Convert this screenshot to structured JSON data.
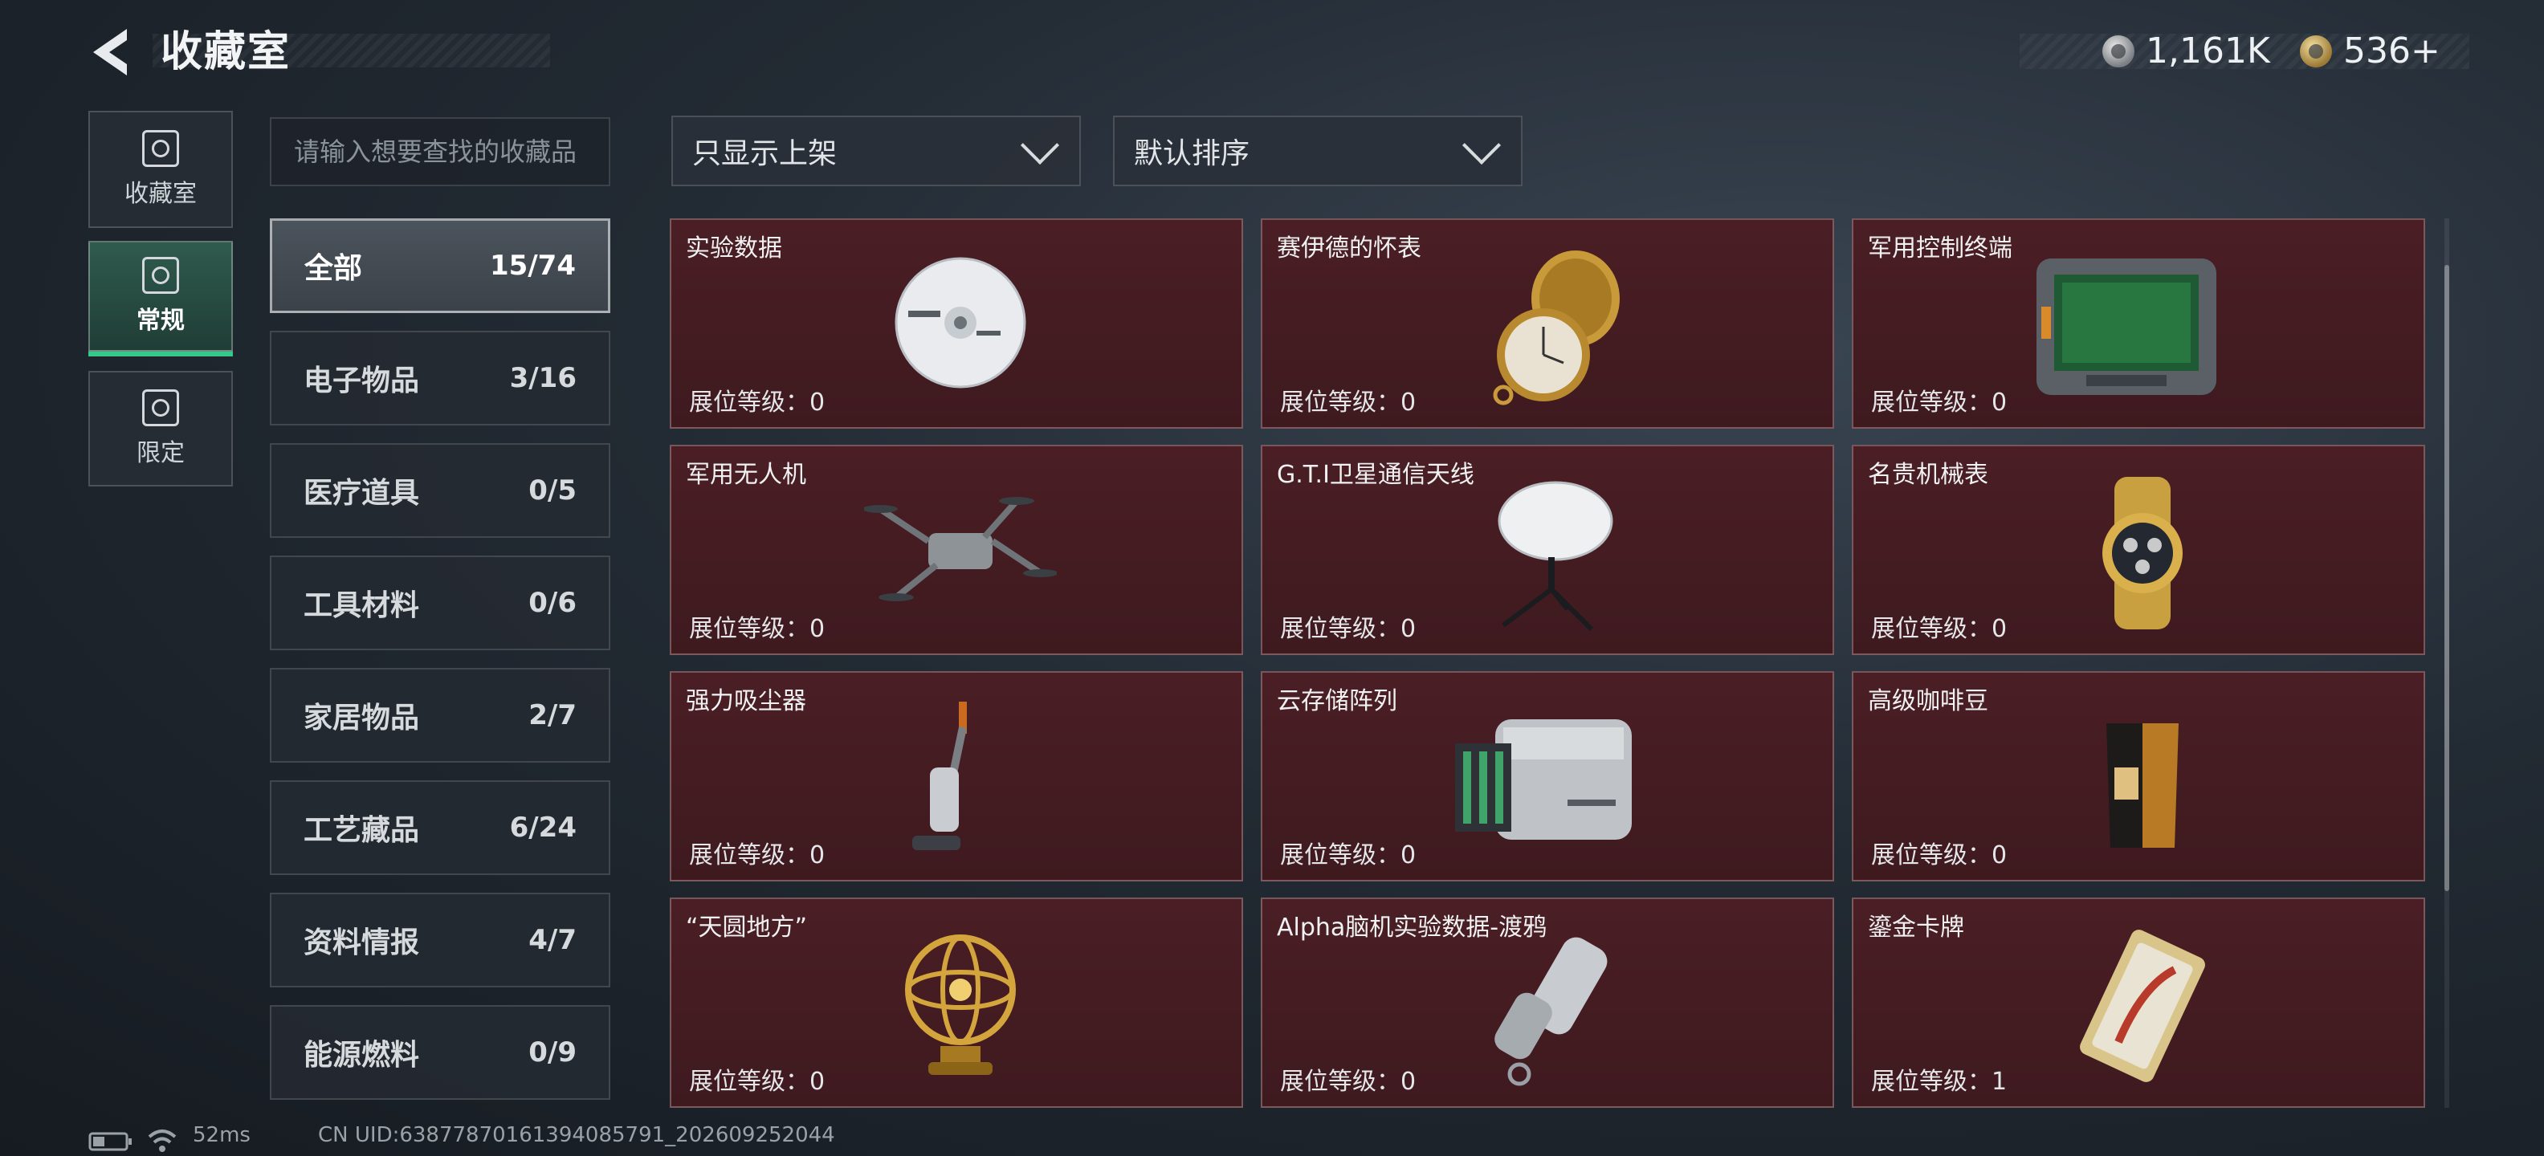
{
  "header": {
    "title": "收藏室",
    "currencies": [
      {
        "icon": "silver-coin-icon",
        "value": "1,161K"
      },
      {
        "icon": "gold-coin-icon",
        "value": "536+"
      }
    ]
  },
  "side_tabs": [
    {
      "label": "收藏室",
      "icon": "collection-room-icon",
      "active": false
    },
    {
      "label": "常规",
      "icon": "regular-icon",
      "active": true
    },
    {
      "label": "限定",
      "icon": "limited-icon",
      "active": false
    }
  ],
  "search": {
    "placeholder": "请输入想要查找的收藏品"
  },
  "filters": {
    "shelf": "只显示上架",
    "sort": "默认排序"
  },
  "categories": [
    {
      "name": "全部",
      "count": "15/74",
      "active": true
    },
    {
      "name": "电子物品",
      "count": "3/16"
    },
    {
      "name": "医疗道具",
      "count": "0/5"
    },
    {
      "name": "工具材料",
      "count": "0/6"
    },
    {
      "name": "家居物品",
      "count": "2/7"
    },
    {
      "name": "工艺藏品",
      "count": "6/24"
    },
    {
      "name": "资料情报",
      "count": "4/7"
    },
    {
      "name": "能源燃料",
      "count": "0/9"
    }
  ],
  "items": [
    {
      "name": "实验数据",
      "level": "展位等级：0",
      "icon": "disc-icon"
    },
    {
      "name": "赛伊德的怀表",
      "level": "展位等级：0",
      "icon": "pocket-watch-icon"
    },
    {
      "name": "军用控制终端",
      "level": "展位等级：0",
      "icon": "control-terminal-icon"
    },
    {
      "name": "军用无人机",
      "level": "展位等级：0",
      "icon": "drone-icon"
    },
    {
      "name": "G.T.I卫星通信天线",
      "level": "展位等级：0",
      "icon": "satellite-antenna-icon"
    },
    {
      "name": "名贵机械表",
      "level": "展位等级：0",
      "icon": "wristwatch-icon"
    },
    {
      "name": "强力吸尘器",
      "level": "展位等级：0",
      "icon": "vacuum-cleaner-icon"
    },
    {
      "name": "云存储阵列",
      "level": "展位等级：0",
      "icon": "storage-array-icon"
    },
    {
      "name": "高级咖啡豆",
      "level": "展位等级：0",
      "icon": "coffee-bag-icon"
    },
    {
      "name": "“天圆地方”",
      "level": "展位等级：0",
      "icon": "armillary-sphere-icon"
    },
    {
      "name": "Alpha脑机实验数据-渡鸦",
      "level": "展位等级：0",
      "icon": "data-canister-icon"
    },
    {
      "name": "鎏金卡牌",
      "level": "展位等级：1",
      "icon": "gilded-card-icon"
    }
  ],
  "status_bar": {
    "latency": "52ms",
    "uid": "CN UID:638778701613940857​91_202609252044"
  }
}
